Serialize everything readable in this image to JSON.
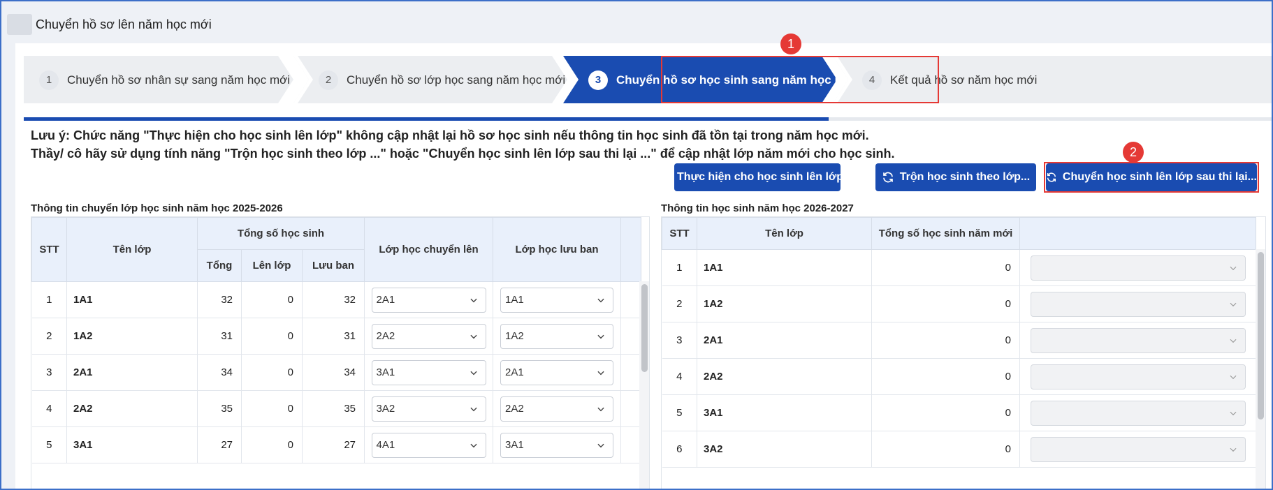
{
  "window": {
    "title": "Chuyển hồ sơ lên năm học mới"
  },
  "steps": [
    {
      "num": "1",
      "label": "Chuyển hồ sơ nhân sự sang năm học mới",
      "active": false
    },
    {
      "num": "2",
      "label": "Chuyển hồ sơ lớp học sang năm học mới",
      "active": false
    },
    {
      "num": "3",
      "label": "Chuyển hồ sơ học sinh sang năm học mới",
      "active": true
    },
    {
      "num": "4",
      "label": "Kết quả hồ sơ năm học mới",
      "active": false
    }
  ],
  "progress": {
    "current_step": 3,
    "total_steps": 4
  },
  "markers": {
    "first": "1",
    "second": "2"
  },
  "note": {
    "line1": "Lưu ý: Chức năng \"Thực hiện cho học sinh lên lớp\" không cập nhật lại hồ sơ học sinh nếu thông tin học sinh đã tồn tại trong năm học mới.",
    "line2": "Thầy/ cô hãy sử dụng tính năng \"Trộn học sinh theo lớp ...\" hoặc \"Chuyển học sinh lên lớp sau thi lại ...\" để cập nhật lớp năm mới cho học sinh."
  },
  "actions": {
    "promote": "Thực hiện cho học sinh lên lớp",
    "merge": "Trộn học sinh theo lớp...",
    "after_retest": "Chuyển học sinh lên lớp sau thi lại..."
  },
  "left_table": {
    "title": "Thông tin chuyển lớp học sinh năm học 2025-2026",
    "headers": {
      "stt": "STT",
      "class_name": "Tên lớp",
      "total_group": "Tổng số học sinh",
      "total": "Tổng",
      "promoted": "Lên lớp",
      "retained": "Lưu ban",
      "target_class": "Lớp học chuyển lên",
      "retained_class": "Lớp học lưu ban"
    },
    "rows": [
      {
        "stt": "1",
        "class_name": "1A1",
        "total": "32",
        "promoted": "0",
        "retained": "32",
        "target_class": "2A1",
        "retained_class": "1A1"
      },
      {
        "stt": "2",
        "class_name": "1A2",
        "total": "31",
        "promoted": "0",
        "retained": "31",
        "target_class": "2A2",
        "retained_class": "1A2"
      },
      {
        "stt": "3",
        "class_name": "2A1",
        "total": "34",
        "promoted": "0",
        "retained": "34",
        "target_class": "3A1",
        "retained_class": "2A1"
      },
      {
        "stt": "4",
        "class_name": "2A2",
        "total": "35",
        "promoted": "0",
        "retained": "35",
        "target_class": "3A2",
        "retained_class": "2A2"
      },
      {
        "stt": "5",
        "class_name": "3A1",
        "total": "27",
        "promoted": "0",
        "retained": "27",
        "target_class": "4A1",
        "retained_class": "3A1"
      }
    ]
  },
  "right_table": {
    "title": "Thông tin học sinh năm học 2026-2027",
    "headers": {
      "stt": "STT",
      "class_name": "Tên lớp",
      "new_total": "Tổng số học sinh năm mới"
    },
    "rows": [
      {
        "stt": "1",
        "class_name": "1A1",
        "new_total": "0"
      },
      {
        "stt": "2",
        "class_name": "1A2",
        "new_total": "0"
      },
      {
        "stt": "3",
        "class_name": "2A1",
        "new_total": "0"
      },
      {
        "stt": "4",
        "class_name": "2A2",
        "new_total": "0"
      },
      {
        "stt": "5",
        "class_name": "3A1",
        "new_total": "0"
      },
      {
        "stt": "6",
        "class_name": "3A2",
        "new_total": "0"
      }
    ]
  },
  "colors": {
    "primary": "#1a4cb1",
    "highlight": "#e53935",
    "header_bg": "#e9f0fb"
  }
}
